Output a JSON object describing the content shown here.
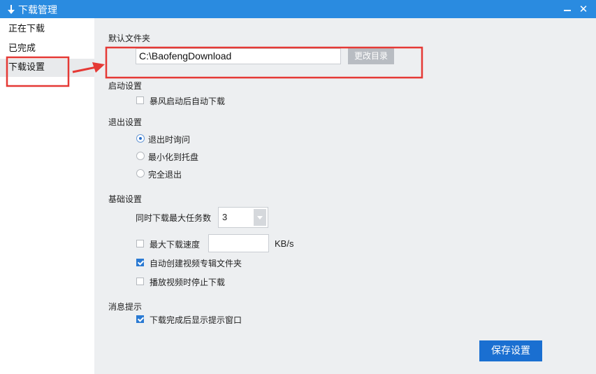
{
  "window": {
    "title": "下载管理",
    "icon": "download-arrow-icon",
    "close_label": "X"
  },
  "sidebar": {
    "items": [
      {
        "label": "正在下载",
        "active": false
      },
      {
        "label": "已完成",
        "active": false
      },
      {
        "label": "下载设置",
        "active": true
      }
    ]
  },
  "settings": {
    "default_folder": {
      "label": "默认文件夹",
      "path": "C:\\BaofengDownload",
      "change_button": "更改目录"
    },
    "startup": {
      "label": "启动设置",
      "auto_download": {
        "label": "暴风启动后自动下载",
        "checked": false
      }
    },
    "exit": {
      "label": "退出设置",
      "options": [
        {
          "label": "退出时询问",
          "selected": true
        },
        {
          "label": "最小化到托盘",
          "selected": false
        },
        {
          "label": "完全退出",
          "selected": false
        }
      ]
    },
    "basic": {
      "label": "基础设置",
      "max_tasks_label": "同时下载最大任务数",
      "max_tasks_value": "3",
      "max_speed": {
        "label": "最大下载速度",
        "checked": false,
        "value": "",
        "unit": "KB/s"
      },
      "auto_album_folder": {
        "label": "自动创建视频专辑文件夹",
        "checked": true
      },
      "stop_on_play": {
        "label": "播放视频时停止下载",
        "checked": false
      }
    },
    "notify": {
      "label": "消息提示",
      "show_popup": {
        "label": "下载完成后显示提示窗口",
        "checked": true
      }
    },
    "save_button": "保存设置"
  },
  "colors": {
    "titlebar": "#2a8be0",
    "accent": "#1a6fd1",
    "annotation": "#e53935"
  }
}
